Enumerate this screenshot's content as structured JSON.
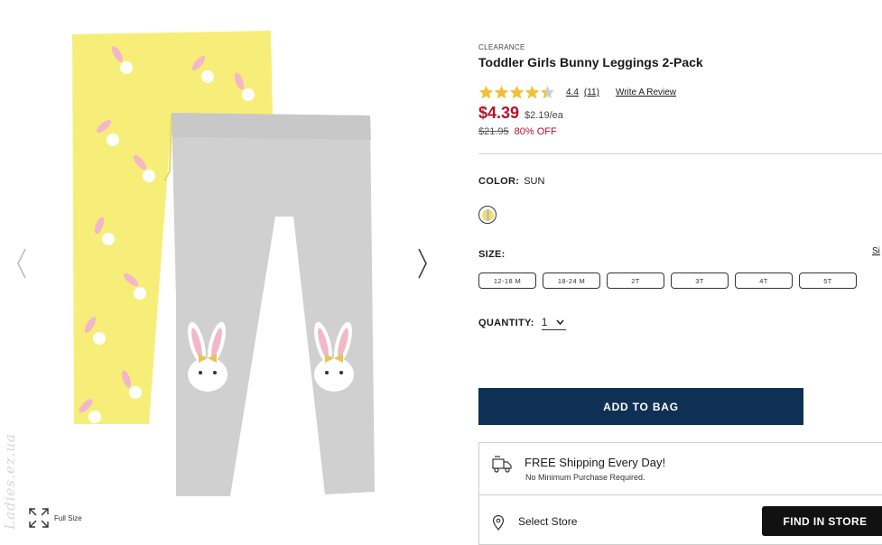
{
  "product": {
    "eyebrow": "CLEARANCE",
    "title": "Toddler Girls Bunny Leggings 2-Pack",
    "rating": {
      "value": "4.4",
      "stars": 4.4,
      "max_stars": 5,
      "count": "(11)",
      "write_review": "Write A Review"
    },
    "price": {
      "current": "$4.39",
      "unit": "$2.19/ea",
      "original": "$21.95",
      "discount": "80% OFF"
    }
  },
  "color": {
    "label": "COLOR:",
    "value": "SUN"
  },
  "size": {
    "label": "SIZE:",
    "guide": "Si",
    "options": [
      "12-18 M",
      "18-24 M",
      "2T",
      "3T",
      "4T",
      "5T"
    ]
  },
  "quantity": {
    "label": "QUANTITY:",
    "value": "1"
  },
  "actions": {
    "add_to_bag": "ADD TO BAG",
    "find_in_store": "FIND IN STORE"
  },
  "shipping": {
    "title": "FREE Shipping Every Day!",
    "subtitle": "No Minimum Purchase Required."
  },
  "store": {
    "label": "Select Store"
  },
  "gallery": {
    "full_size": "Full Size",
    "watermark": "Ladies.ez.ua"
  },
  "colors": {
    "price_red": "#b5122a",
    "bag_navy": "#0e3054",
    "star_gold": "#f2c12e"
  }
}
